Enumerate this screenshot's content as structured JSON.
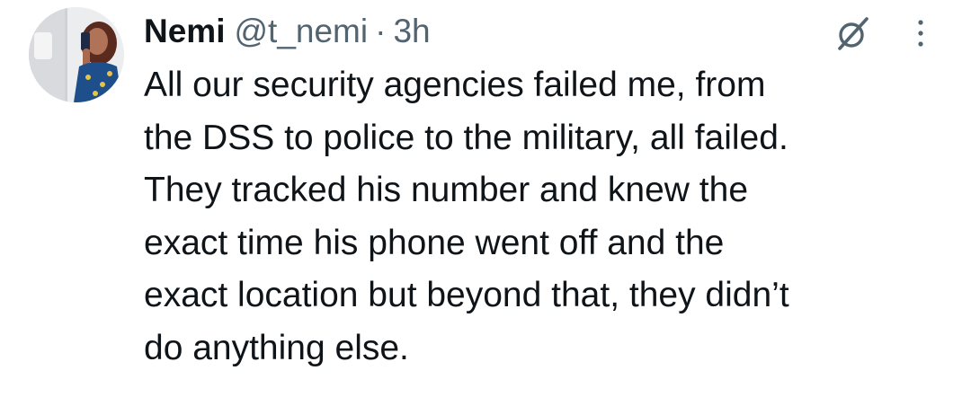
{
  "author": {
    "display_name": "Nemi",
    "handle": "@t_nemi",
    "separator": "·",
    "time": "3h"
  },
  "tweet": {
    "text": "All our security agencies failed me, from\nthe DSS to police to the military, all failed.\nThey tracked his number and knew the\nexact time his phone went off and the\nexact location but beyond that, they didn’t\ndo anything else."
  },
  "icons": {
    "avatar": "profile-photo",
    "grok": "grok-icon",
    "more": "more-vertical-icon"
  },
  "colors": {
    "text": "#0f1419",
    "secondary": "#536471",
    "background": "#ffffff"
  }
}
